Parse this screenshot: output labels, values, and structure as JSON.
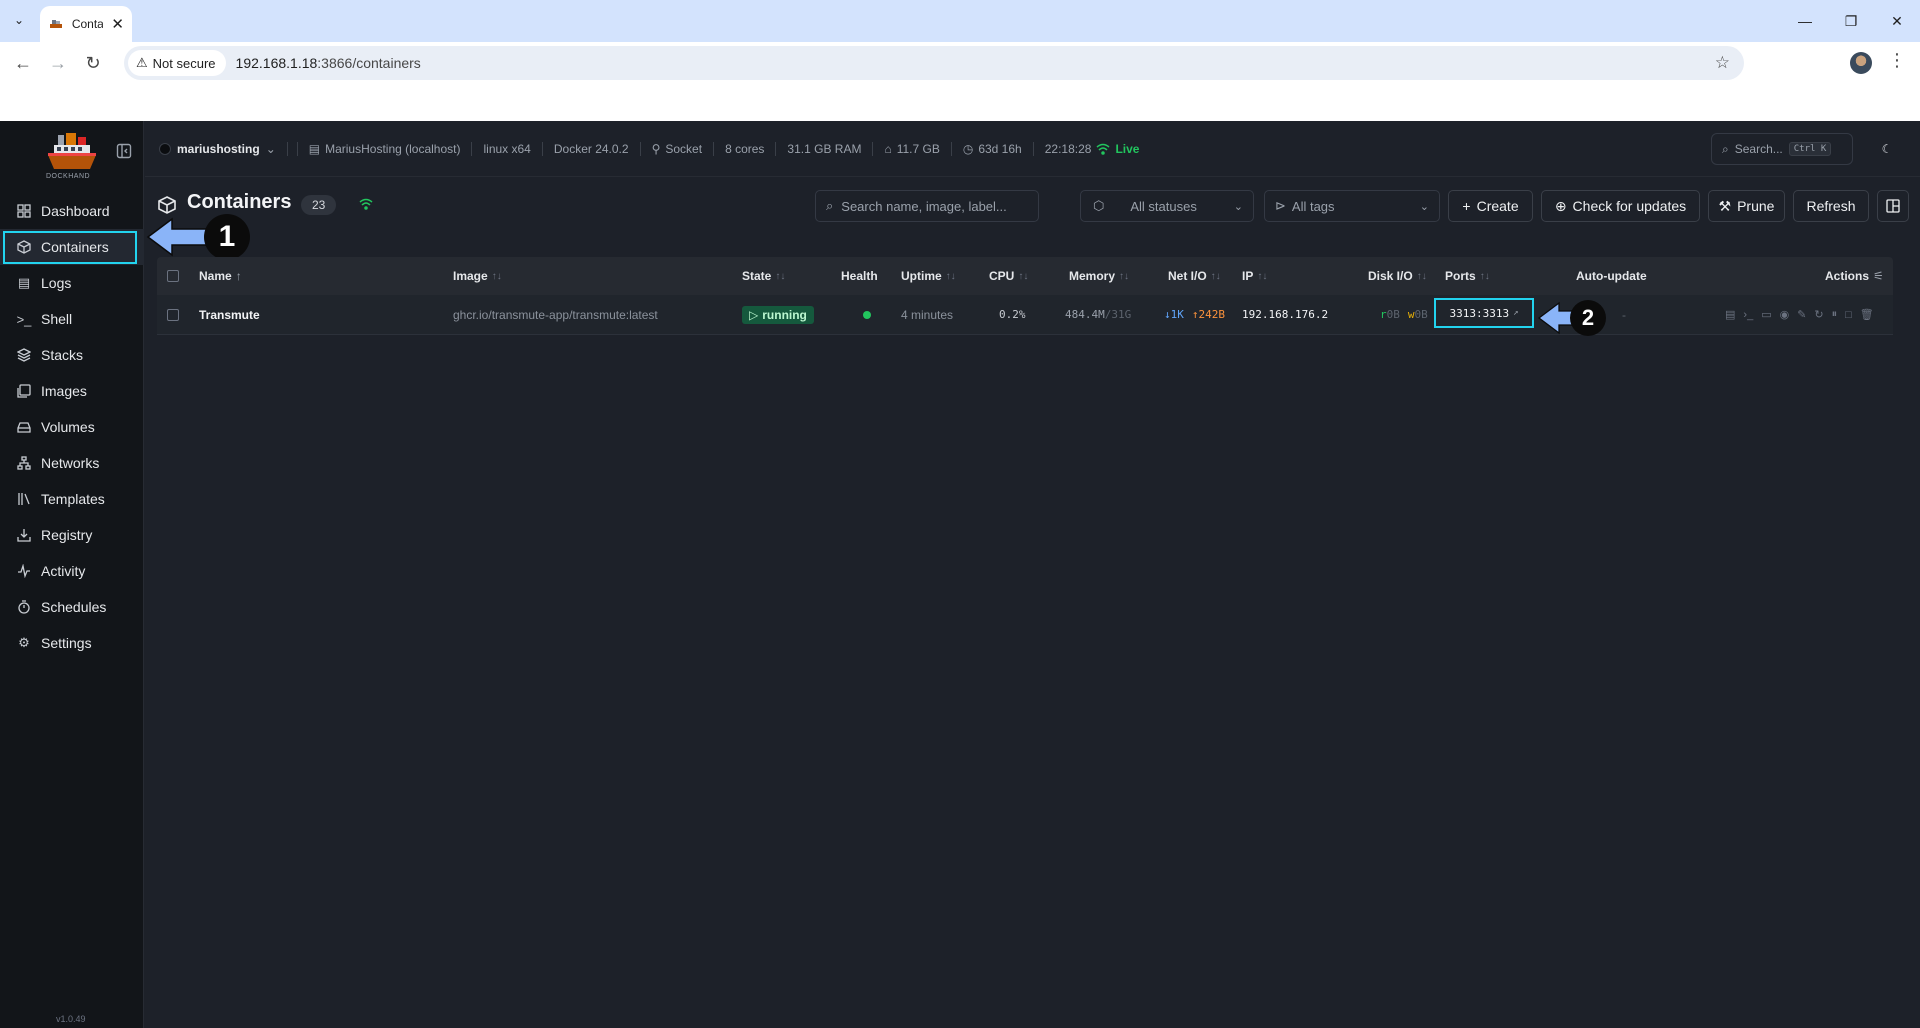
{
  "browser": {
    "tab_title": "Conta",
    "not_secure": "Not secure",
    "url_host": "192.168.1.18",
    "url_rest": ":3866/containers"
  },
  "sidebar": {
    "logo_text": "DOCKHAND",
    "items": [
      {
        "label": "Dashboard",
        "icon": "grid-icon"
      },
      {
        "label": "Containers",
        "icon": "box-icon"
      },
      {
        "label": "Logs",
        "icon": "scroll-icon"
      },
      {
        "label": "Shell",
        "icon": "terminal-icon"
      },
      {
        "label": "Stacks",
        "icon": "layers-icon"
      },
      {
        "label": "Images",
        "icon": "images-icon"
      },
      {
        "label": "Volumes",
        "icon": "hard-drive-icon"
      },
      {
        "label": "Networks",
        "icon": "network-icon"
      },
      {
        "label": "Templates",
        "icon": "library-icon"
      },
      {
        "label": "Registry",
        "icon": "download-icon"
      },
      {
        "label": "Activity",
        "icon": "activity-icon"
      },
      {
        "label": "Schedules",
        "icon": "timer-icon"
      },
      {
        "label": "Settings",
        "icon": "gear-icon"
      }
    ],
    "active_index": 1,
    "version": "v1.0.49"
  },
  "topbar": {
    "env_name": "mariushosting",
    "host": "MariusHosting (localhost)",
    "os": "linux x64",
    "docker": "Docker 24.0.2",
    "conn": "Socket",
    "cores": "8 cores",
    "ram": "31.1 GB RAM",
    "disk": "11.7 GB",
    "uptime": "63d 16h",
    "time": "22:18:28",
    "live": "Live",
    "search_placeholder": "Search...",
    "search_kbd": "Ctrl K"
  },
  "page": {
    "title": "Containers",
    "count": "23",
    "search_placeholder": "Search name, image, label...",
    "status_filter": "All statuses",
    "tags_filter": "All tags",
    "btn_create": "Create",
    "btn_check": "Check for updates",
    "btn_prune": "Prune",
    "btn_refresh": "Refresh"
  },
  "table": {
    "headers": {
      "name": "Name",
      "image": "Image",
      "state": "State",
      "health": "Health",
      "uptime": "Uptime",
      "cpu": "CPU",
      "memory": "Memory",
      "netio": "Net I/O",
      "ip": "IP",
      "diskio": "Disk I/O",
      "ports": "Ports",
      "autoupdate": "Auto-update",
      "actions": "Actions"
    },
    "rows": [
      {
        "name": "Transmute",
        "image": "ghcr.io/transmute-app/transmute:latest",
        "state": "running",
        "uptime": "4 minutes",
        "cpu": "0.2%",
        "memory_used": "484.4M",
        "memory_total": "/31G",
        "net_down": "↓1K",
        "net_up": "↑242B",
        "ip": "192.168.176.2",
        "disk_r_label": "r",
        "disk_r": "0B",
        "disk_w_label": "w",
        "disk_w": "0B",
        "ports": "3313:3313",
        "autoupdate": "-"
      }
    ]
  },
  "annotations": {
    "callout1": "1",
    "callout2": "2"
  },
  "colors": {
    "accent_cyan": "#22d3ee",
    "callout_arrow": "#8ab4f8",
    "running_green": "#15593d",
    "live_green": "#22c55e"
  }
}
